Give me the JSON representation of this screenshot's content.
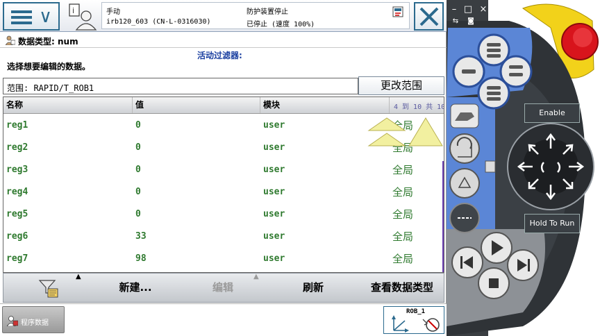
{
  "status": {
    "mode": "手动",
    "system": "irb120_603 (CN-L-0316030)",
    "state_line1": "防护装置停止",
    "state_line2": "已停止 (速度 100%)"
  },
  "data_type": "数据类型: num",
  "filter_label": "活动过滤器:",
  "instruction": "选择想要编辑的数据。",
  "scope": {
    "label": "范围: RAPID/T_ROB1",
    "change_button": "更改范围"
  },
  "table": {
    "headers": [
      "名称",
      "值",
      "模块"
    ],
    "pager": "4 到 10 共 10",
    "rows": [
      {
        "name": "reg1",
        "value": "0",
        "module": "user",
        "scope": "全局"
      },
      {
        "name": "reg2",
        "value": "0",
        "module": "user",
        "scope": "全局"
      },
      {
        "name": "reg3",
        "value": "0",
        "module": "user",
        "scope": "全局"
      },
      {
        "name": "reg4",
        "value": "0",
        "module": "user",
        "scope": "全局"
      },
      {
        "name": "reg5",
        "value": "0",
        "module": "user",
        "scope": "全局"
      },
      {
        "name": "reg6",
        "value": "33",
        "module": "user",
        "scope": "全局"
      },
      {
        "name": "reg7",
        "value": "98",
        "module": "user",
        "scope": "全局"
      }
    ]
  },
  "toolbar": {
    "new": "新建...",
    "edit": "编辑",
    "refresh": "刷新",
    "view_type": "查看数据类型"
  },
  "taskbar": {
    "program_data": "程序数据",
    "quickset_unit": "ROB_1"
  },
  "pendant": {
    "enable": "Enable",
    "hold_to_run": "Hold To Run"
  },
  "colors": {
    "accent": "#2b6a8e",
    "row_text": "#2f7a2f",
    "filter_text": "#1a3fa0",
    "pendant_blue": "#5b86d6",
    "pendant_dark": "#2f3337",
    "emergency_red": "#d8141c",
    "enable_yellow": "#f2d21a"
  }
}
